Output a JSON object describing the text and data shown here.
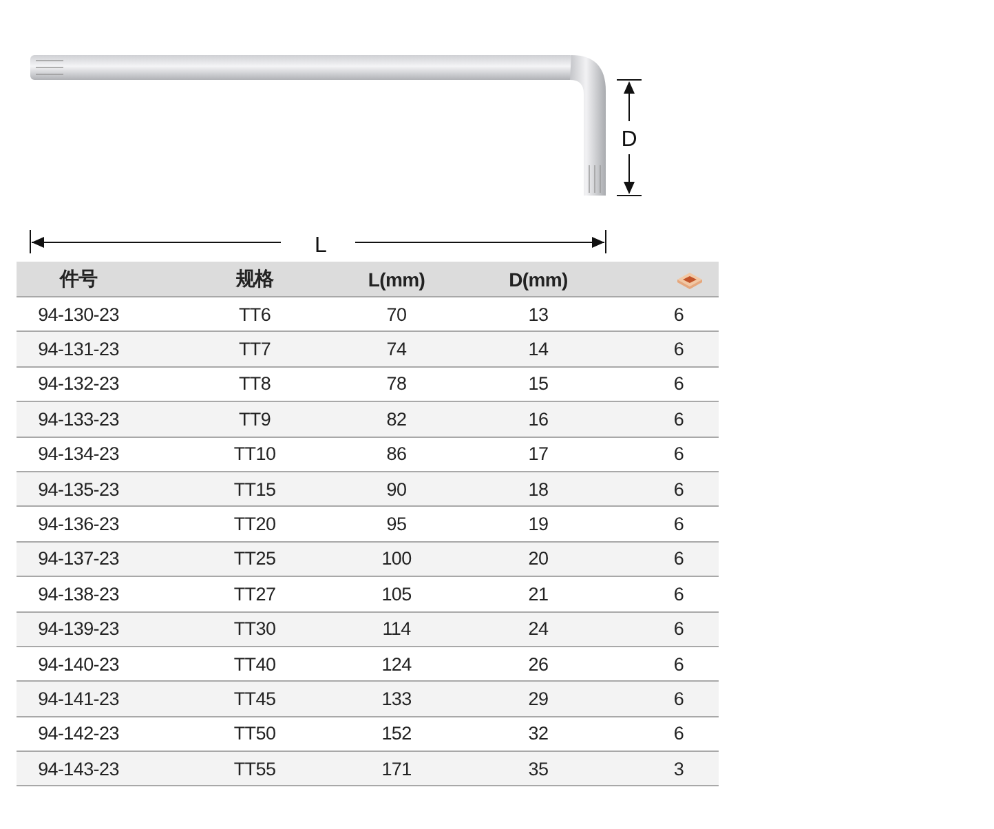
{
  "diagram": {
    "length_label": "L",
    "depth_label": "D"
  },
  "table": {
    "columns": [
      "件号",
      "规格",
      "L(mm)",
      "D(mm)"
    ],
    "rows": [
      [
        "94-130-23",
        "TT6",
        "70",
        "13",
        "6"
      ],
      [
        "94-131-23",
        "TT7",
        "74",
        "14",
        "6"
      ],
      [
        "94-132-23",
        "TT8",
        "78",
        "15",
        "6"
      ],
      [
        "94-133-23",
        "TT9",
        "82",
        "16",
        "6"
      ],
      [
        "94-134-23",
        "TT10",
        "86",
        "17",
        "6"
      ],
      [
        "94-135-23",
        "TT15",
        "90",
        "18",
        "6"
      ],
      [
        "94-136-23",
        "TT20",
        "95",
        "19",
        "6"
      ],
      [
        "94-137-23",
        "TT25",
        "100",
        "20",
        "6"
      ],
      [
        "94-138-23",
        "TT27",
        "105",
        "21",
        "6"
      ],
      [
        "94-139-23",
        "TT30",
        "114",
        "24",
        "6"
      ],
      [
        "94-140-23",
        "TT40",
        "124",
        "26",
        "6"
      ],
      [
        "94-141-23",
        "TT45",
        "133",
        "29",
        "6"
      ],
      [
        "94-142-23",
        "TT50",
        "152",
        "32",
        "6"
      ],
      [
        "94-143-23",
        "TT55",
        "171",
        "35",
        "3"
      ]
    ]
  }
}
